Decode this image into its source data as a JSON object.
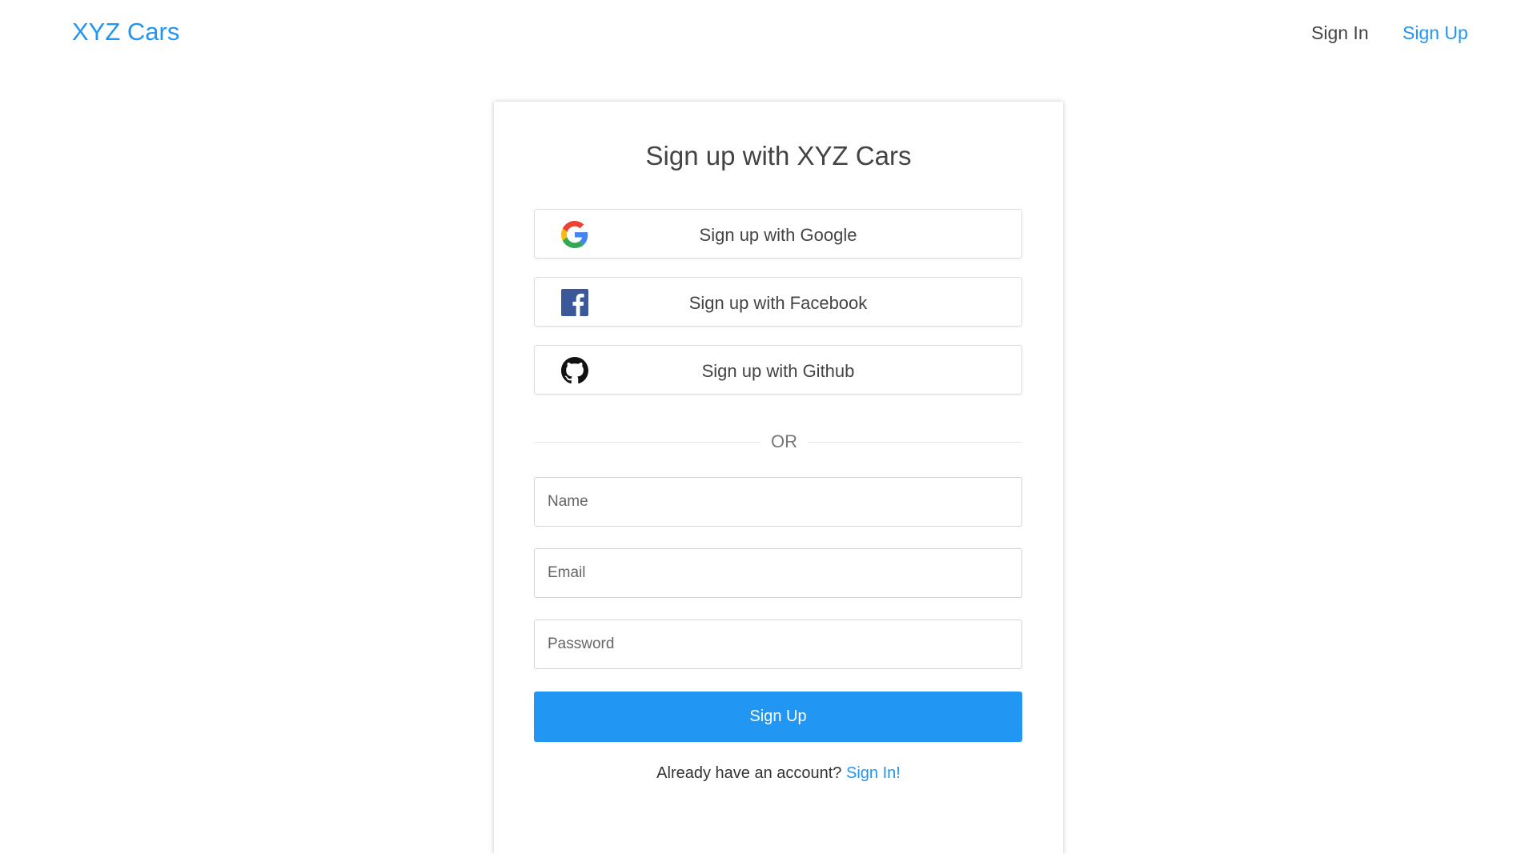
{
  "header": {
    "brand": "XYZ Cars",
    "nav": {
      "sign_in": "Sign In",
      "sign_up": "Sign Up"
    }
  },
  "card": {
    "title": "Sign up with XYZ Cars",
    "social_buttons": [
      {
        "label": "Sign up with Google",
        "icon": "google-icon"
      },
      {
        "label": "Sign up with Facebook",
        "icon": "facebook-icon"
      },
      {
        "label": "Sign up with Github",
        "icon": "github-icon"
      }
    ],
    "divider": "OR",
    "fields": {
      "name": {
        "placeholder": "Name",
        "value": ""
      },
      "email": {
        "placeholder": "Email",
        "value": ""
      },
      "password": {
        "placeholder": "Password",
        "value": ""
      }
    },
    "submit_label": "Sign Up",
    "footer": {
      "prompt": "Already have an account?",
      "link": "Sign In!"
    }
  },
  "colors": {
    "accent": "#2196f3",
    "facebook": "#3b5998",
    "google_blue": "#4285f4",
    "google_red": "#ea4335",
    "google_yellow": "#fbbc05",
    "google_green": "#34a853"
  }
}
